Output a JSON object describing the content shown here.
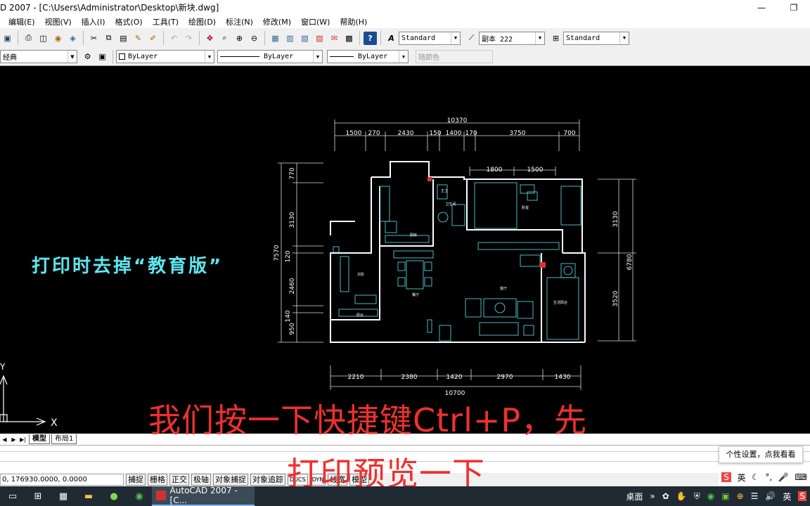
{
  "window": {
    "title": "D 2007 - [C:\\Users\\Administrator\\Desktop\\新块.dwg]",
    "minimize": "—",
    "maximize": "❐"
  },
  "menu": [
    "编辑(E)",
    "视图(V)",
    "插入(I)",
    "格式(O)",
    "工具(T)",
    "绘图(D)",
    "标注(N)",
    "修改(M)",
    "窗口(W)",
    "帮助(H)"
  ],
  "toolbar1": {
    "text_style": "Standard",
    "dim_style": "副本 222",
    "table_style": "Standard"
  },
  "toolbar2": {
    "workspace": "经典",
    "layer": "ByLayer",
    "linetype": "ByLayer",
    "lineweight": "ByLayer",
    "plotstyle": "随颜色"
  },
  "drawing": {
    "dims_top_total": "10370",
    "dims_top": [
      "1500",
      "270",
      "2430",
      "150",
      "1400",
      "170",
      "3750",
      "700"
    ],
    "dims_inner_top": [
      "1800",
      "1500"
    ],
    "dims_left": [
      "770",
      "3130",
      "7570",
      "120",
      "2460",
      "140",
      "950"
    ],
    "dims_right": [
      "3130",
      "6780",
      "3520"
    ],
    "dims_bottom": [
      "2210",
      "2380",
      "1420",
      "2970",
      "1430"
    ],
    "dims_bottom_total": "10700",
    "room_labels": [
      "卫生间",
      "卧室",
      "厨房",
      "次卧",
      "客厅",
      "餐厅",
      "生活阳台",
      "阳台",
      "主卫"
    ],
    "ucs_x": "X",
    "ucs_y": "Y"
  },
  "overlay_note": "打印时去掉“教育版”",
  "tabs": {
    "nav": [
      "◀",
      "▶",
      "▶|"
    ],
    "model": "模型",
    "layout1": "布局1"
  },
  "status": {
    "coords": "0, 176930.0000, 0.0000",
    "buttons": [
      "捕捉",
      "栅格",
      "正交",
      "极轴",
      "对象捕捉",
      "对象追踪",
      "DUCS",
      "DYN",
      "线宽",
      "模型"
    ]
  },
  "subtitles": {
    "line1": "我们按一下快捷键Ctrl+P，先",
    "line2": "打印预览一下"
  },
  "tooltip": "个性设置，点我看看",
  "taskbar": {
    "app": "AutoCAD 2007 - [C...",
    "desktop": "桌面",
    "chevron": "»",
    "ime": "英",
    "tray_lang": "英"
  },
  "colors": {
    "cad_background": "#000000",
    "wall_line": "#ffffff",
    "furniture": "#5fe6f0",
    "subtitle": "#f03030",
    "overlay_note": "#5fe6f0"
  }
}
